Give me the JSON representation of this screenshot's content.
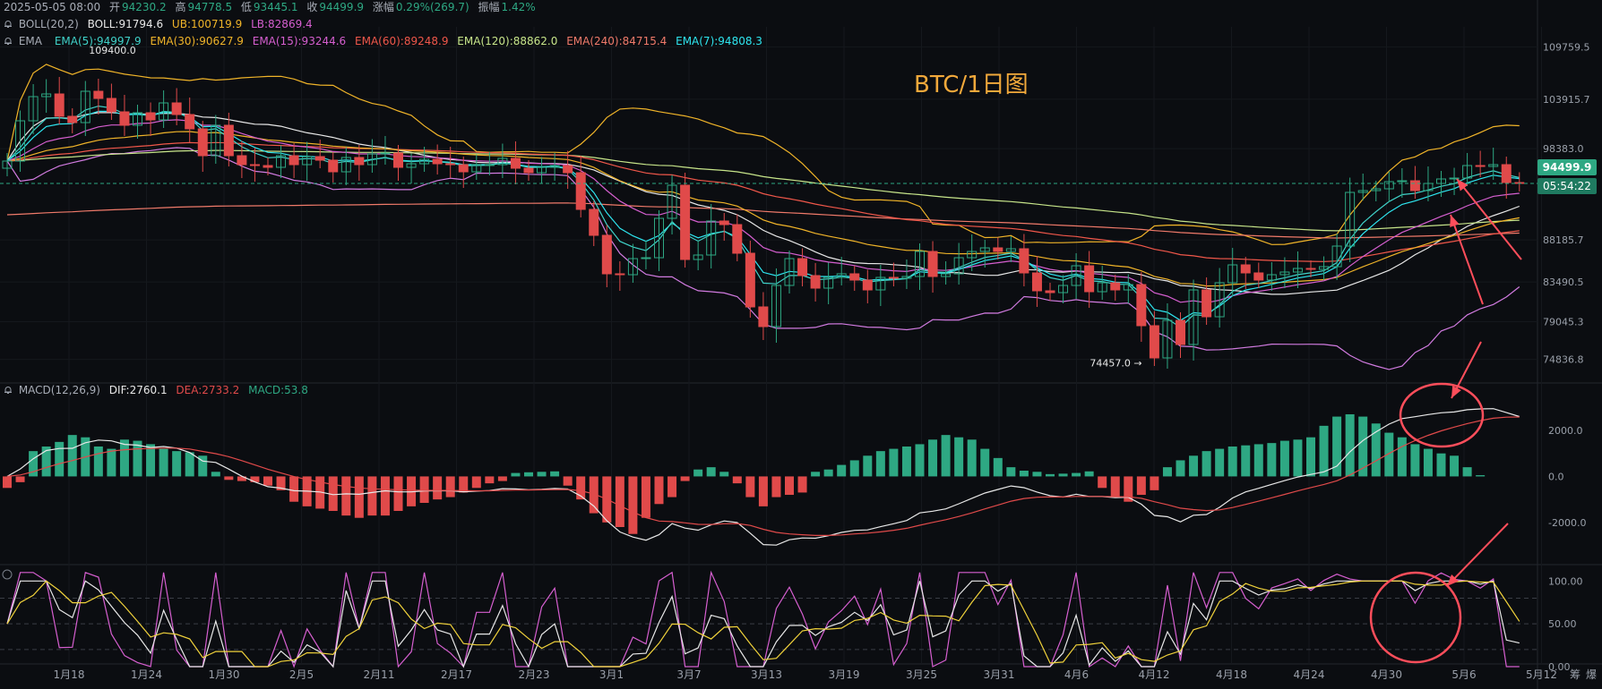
{
  "title": "BTC/1日图",
  "header": {
    "date": "2025-05-05 08:00",
    "open_label": "开",
    "open": "94230.2",
    "high_label": "高",
    "high": "94778.5",
    "low_label": "低",
    "low": "93445.1",
    "close_label": "收",
    "close": "94499.9",
    "change_label": "涨幅",
    "change": "0.29%(269.7)",
    "amp_label": "振幅",
    "amp": "1.42%"
  },
  "boll": {
    "name": "BOLL(20,2)",
    "mid": "BOLL:91794.6",
    "ub": "UB:100719.9",
    "lb": "LB:82869.4"
  },
  "ema": {
    "name": "EMA",
    "items": [
      {
        "label": "EMA(5):94997.9",
        "color": "#3fd1c8"
      },
      {
        "label": "EMA(30):90627.9",
        "color": "#f0b429"
      },
      {
        "label": "EMA(15):93244.6",
        "color": "#d65fd0"
      },
      {
        "label": "EMA(60):89248.9",
        "color": "#f0574a"
      },
      {
        "label": "EMA(120):88862.0",
        "color": "#c7e58a"
      },
      {
        "label": "EMA(240):84715.4",
        "color": "#f07a6a"
      },
      {
        "label": "EMA(7):94808.3",
        "color": "#2ee6f0"
      }
    ]
  },
  "macd": {
    "name": "MACD(12,26,9)",
    "dif": "DIF:2760.1",
    "dea": "DEA:2733.2",
    "macd": "MACD:53.8"
  },
  "current_price": "94499.9",
  "countdown": "05:54:22",
  "low_annotation": "74457.0",
  "high_annotation": "109400.0",
  "colors": {
    "up": "#2ea883",
    "down": "#e04a4a",
    "bg": "#0b0d11",
    "boll": "#d17be0"
  },
  "chart_data": [
    {
      "type": "candlestick",
      "title": "BTC/1日图",
      "y_ticks": [
        "109759.5",
        "103915.7",
        "98383.0",
        "88185.7",
        "83490.5",
        "79045.3",
        "74836.8"
      ],
      "ylim": [
        72500,
        112000
      ],
      "x_labels": [
        "1月18",
        "1月24",
        "1月30",
        "2月5",
        "2月11",
        "2月17",
        "2月23",
        "3月1",
        "3月7",
        "3月13",
        "3月19",
        "3月25",
        "3月31",
        "4月6",
        "4月12",
        "4月18",
        "4月24",
        "4月30",
        "5月6",
        "5月12"
      ],
      "close": [
        97000,
        101500,
        104200,
        104500,
        102000,
        101300,
        104800,
        104000,
        102500,
        101000,
        102400,
        101600,
        103500,
        102200,
        100600,
        97600,
        101000,
        97600,
        96600,
        96500,
        96300,
        97600,
        96600,
        97500,
        97100,
        95800,
        97400,
        96600,
        97800,
        97900,
        96300,
        96700,
        97200,
        96700,
        96600,
        95800,
        96600,
        96600,
        97300,
        96200,
        95700,
        96300,
        96500,
        95700,
        91600,
        88700,
        84400,
        84300,
        86100,
        86200,
        90600,
        94300,
        86000,
        86500,
        90300,
        89900,
        86700,
        80700,
        78500,
        83100,
        86100,
        84200,
        82800,
        84000,
        84400,
        83700,
        82600,
        84000,
        83900,
        84100,
        86900,
        84100,
        84400,
        86200,
        86900,
        87300,
        86900,
        87200,
        84500,
        82500,
        82300,
        83100,
        85300,
        82400,
        83400,
        82600,
        83200,
        78600,
        75000,
        79200,
        76500,
        82600,
        79600,
        83400,
        85400,
        84500,
        83700,
        84300,
        84600,
        85000,
        84900,
        85200,
        87500,
        93500,
        93700,
        93900,
        94700,
        94800,
        93700,
        94500,
        95000,
        95100,
        96500,
        96400,
        96600,
        94600,
        94500
      ]
    },
    {
      "type": "macd",
      "y_ticks": [
        "2000.0",
        "0.0",
        "-2000.0"
      ],
      "ylim": [
        -3600,
        3400
      ],
      "hist": [
        -500,
        -250,
        1100,
        1300,
        1500,
        1800,
        1700,
        1300,
        1200,
        1600,
        1550,
        1400,
        1200,
        1100,
        1050,
        900,
        200,
        -150,
        -200,
        -250,
        -400,
        -600,
        -1100,
        -1300,
        -1400,
        -1500,
        -1700,
        -1800,
        -1700,
        -1700,
        -1500,
        -1300,
        -1150,
        -1000,
        -900,
        -700,
        -500,
        -300,
        -200,
        150,
        180,
        200,
        220,
        -400,
        -1000,
        -1600,
        -2000,
        -2200,
        -2500,
        -1800,
        -1200,
        -900,
        -200,
        300,
        400,
        200,
        -300,
        -900,
        -1300,
        -900,
        -800,
        -700,
        200,
        300,
        500,
        700,
        900,
        1100,
        1200,
        1300,
        1400,
        1600,
        1800,
        1700,
        1600,
        1200,
        800,
        400,
        250,
        200,
        100,
        120,
        150,
        220,
        -500,
        -900,
        -1100,
        -800,
        -600,
        400,
        700,
        900,
        1100,
        1200,
        1300,
        1350,
        1400,
        1450,
        1550,
        1600,
        1700,
        2200,
        2600,
        2700,
        2600,
        2300,
        1900,
        1700,
        1400,
        1200,
        1000,
        900,
        400,
        53.8
      ]
    },
    {
      "type": "oscillator",
      "y_ticks": [
        "100.00",
        "50.00",
        "0.00"
      ],
      "ylim": [
        0,
        115
      ]
    }
  ]
}
